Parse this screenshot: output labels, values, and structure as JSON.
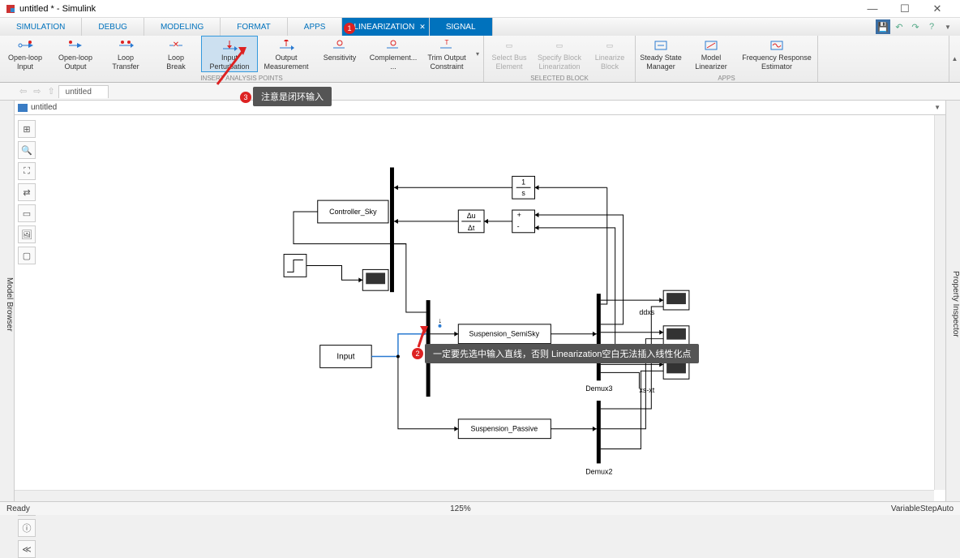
{
  "window": {
    "title": "untitled * - Simulink"
  },
  "tabs": {
    "simulation": "SIMULATION",
    "debug": "DEBUG",
    "modeling": "MODELING",
    "format": "FORMAT",
    "apps": "APPS",
    "linearization": "LINEARIZATION",
    "signal": "SIGNAL"
  },
  "toolstrip": {
    "analysis_points_label": "INSERT ANALYSIS POINTS",
    "open_loop_input": "Open-loop\nInput",
    "open_loop_output": "Open-loop\nOutput",
    "loop_transfer": "Loop\nTransfer",
    "loop_break": "Loop\nBreak",
    "input_perturbation": "Input\nPerturbation",
    "output_measurement": "Output\nMeasurement",
    "sensitivity": "Sensitivity",
    "complement": "Complement...\n...",
    "trim_output": "Trim Output\nConstraint",
    "selected_block_label": "SELECTED BLOCK",
    "select_bus_element": "Select Bus\nElement",
    "specify_block_lin": "Specify Block\nLinearization",
    "linearize_block": "Linearize\nBlock",
    "apps_label": "APPS",
    "steady_state_manager": "Steady State\nManager",
    "model_linearizer": "Model\nLinearizer",
    "freq_response": "Frequency Response\nEstimator"
  },
  "explorer": {
    "tab": "untitled",
    "canvas_title": "untitled"
  },
  "side": {
    "left": "Model Browser",
    "right": "Property Inspector"
  },
  "blocks": {
    "controller_sky": "Controller_Sky",
    "suspension_semisky": "Suspension_SemiSky",
    "suspension_passive": "Suspension_Passive",
    "input": "Input",
    "demux3": "Demux3",
    "demux2": "Demux2",
    "ddxs": "ddxs",
    "xs_xt": "xs-xt",
    "integrator": "1\ns",
    "deriv": "Δu\nΔt"
  },
  "annotations": {
    "a1": "注意是闭环输入",
    "a2": "一定要先选中输入直线，否则 Linearization空白无法插入线性化点"
  },
  "status": {
    "ready": "Ready",
    "zoom": "125%",
    "solver": "VariableStepAuto"
  }
}
